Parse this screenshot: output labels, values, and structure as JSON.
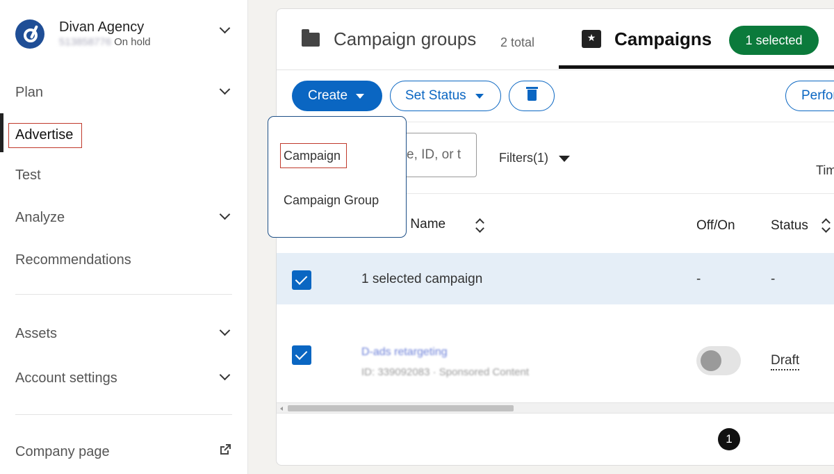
{
  "account": {
    "name": "Divan Agency",
    "id": "513858776",
    "status": "On hold"
  },
  "sidebar": {
    "items": [
      {
        "label": "Plan"
      },
      {
        "label": "Advertise"
      },
      {
        "label": "Test"
      },
      {
        "label": "Analyze"
      },
      {
        "label": "Recommendations"
      },
      {
        "label": "Assets"
      },
      {
        "label": "Account settings"
      },
      {
        "label": "Company page"
      }
    ]
  },
  "tabs": {
    "groups_label": "Campaign groups",
    "groups_count": "2 total",
    "campaigns_label": "Campaigns",
    "selected_badge": "1 selected"
  },
  "toolbar": {
    "create_label": "Create",
    "set_status_label": "Set Status",
    "performance_label": "Perfor"
  },
  "dropdown": {
    "items": [
      "Campaign",
      "Campaign Group"
    ]
  },
  "search": {
    "placeholder": "e, ID, or t"
  },
  "filters_label": "Filters(1)",
  "time_label": "Tim",
  "table": {
    "columns": [
      "gn Name",
      "Off/On",
      "Status"
    ],
    "selected_row": {
      "label": "1 selected campaign",
      "offon": "-",
      "status": "-"
    },
    "rows": [
      {
        "name": "D-ads retargeting",
        "meta": "ID: 339092083 · Sponsored Content",
        "toggle": "off",
        "status": "Draft"
      }
    ]
  },
  "pagination": {
    "current": "1"
  },
  "colors": {
    "primary": "#0a66c2",
    "success_badge": "#0b7a3b",
    "selected_row_bg": "#e5eef7",
    "highlight_box": "#c0392b"
  }
}
